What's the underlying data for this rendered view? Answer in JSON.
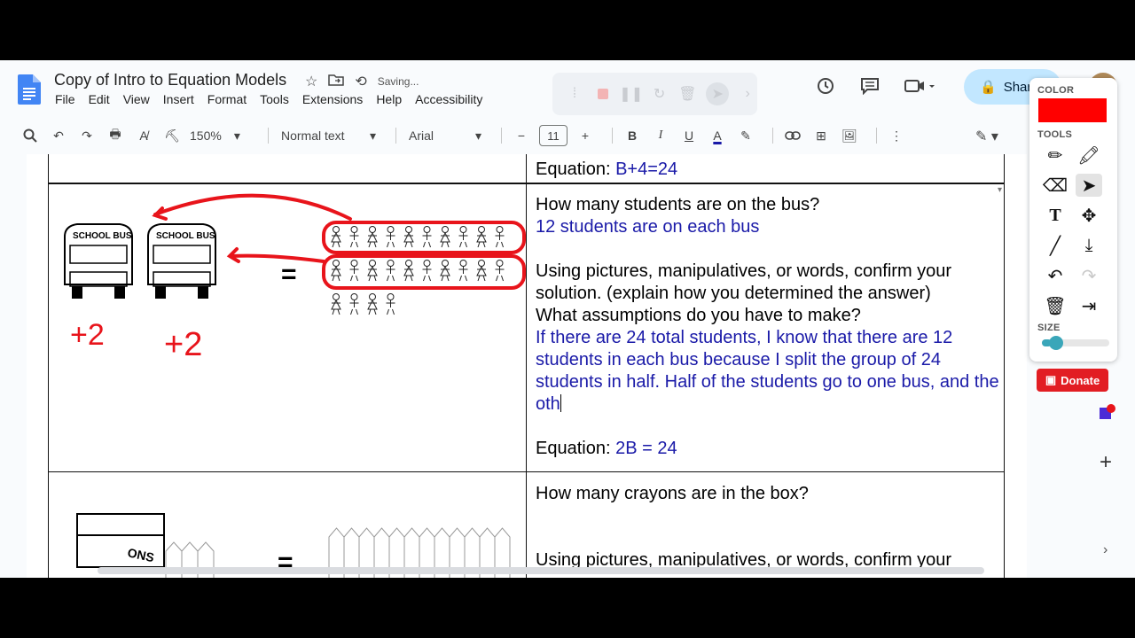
{
  "app": {
    "title": "Copy of Intro to Equation Models",
    "saving_status": "Saving...",
    "share_label": "Shar",
    "menu": [
      "File",
      "Edit",
      "View",
      "Insert",
      "Format",
      "Tools",
      "Extensions",
      "Help",
      "Accessibility"
    ]
  },
  "toolbar": {
    "zoom": "150%",
    "style": "Normal text",
    "font": "Arial",
    "font_size": "11",
    "bold_label": "B",
    "italic_label": "I",
    "underline_label": "U",
    "text_color_label": "A",
    "minus_label": "−",
    "plus_label": "+"
  },
  "document": {
    "row0": {
      "equation_label": "Equation: ",
      "equation_value": "B+4=24"
    },
    "row1": {
      "question": "How many students are on the bus?",
      "answer": "12 students are on each bus",
      "prompt1": "Using pictures, manipulatives, or words, confirm your solution. (explain how you determined the answer)",
      "prompt2": "What assumptions do you have to make?",
      "explanation": "If there are 24 total students, I know that there are 12 students in each bus because I split the group of 24 students in half. Half of the students go to one bus, and the oth",
      "equation_label": "Equation: ",
      "equation_value": "2B = 24",
      "bus_label": "SCHOOL BUS",
      "ink_left": "+2",
      "ink_right": "+2",
      "equals": "="
    },
    "row2": {
      "question": "How many crayons are in the box?",
      "prompt1": "Using pictures, manipulatives, or words, confirm your",
      "box_label": "ONS",
      "equals": "="
    }
  },
  "draw_panel": {
    "color_label": "COLOR",
    "tools_label": "TOOLS",
    "size_label": "SIZE",
    "color": "#ff0000",
    "size_level": 0.1,
    "donate_label": "Donate"
  }
}
